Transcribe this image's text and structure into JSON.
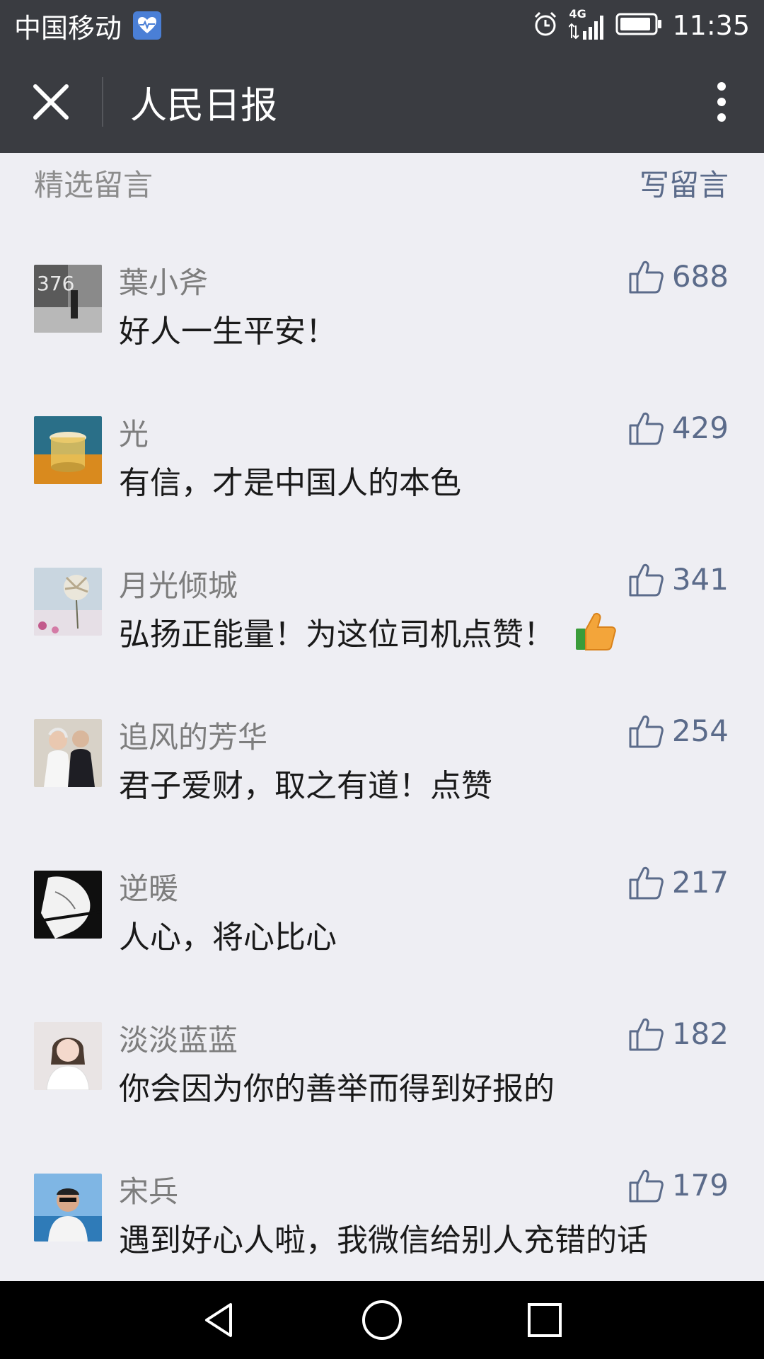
{
  "status_bar": {
    "carrier": "中国移动",
    "network": "4G",
    "time": "11:35"
  },
  "title_bar": {
    "title": "人民日报"
  },
  "section": {
    "title": "精选留言",
    "write_label": "写留言"
  },
  "comments": [
    {
      "nickname": "葉小斧",
      "text": "好人一生平安！",
      "likes": "688",
      "avatar": "avatar-376",
      "emoji": ""
    },
    {
      "nickname": "光",
      "text": "有信，才是中国人的本色",
      "likes": "429",
      "avatar": "avatar-glass",
      "emoji": ""
    },
    {
      "nickname": "月光倾城",
      "text": "弘扬正能量！为这位司机点赞！",
      "likes": "341",
      "avatar": "avatar-flower",
      "emoji": "thumbs-up-emoji"
    },
    {
      "nickname": "追风的芳华",
      "text": "君子爱财，取之有道！点赞",
      "likes": "254",
      "avatar": "avatar-wedding",
      "emoji": ""
    },
    {
      "nickname": "逆暖",
      "text": "人心，将心比心",
      "likes": "217",
      "avatar": "avatar-sketch",
      "emoji": ""
    },
    {
      "nickname": "淡淡蓝蓝",
      "text": "你会因为你的善举而得到好报的",
      "likes": "182",
      "avatar": "avatar-girl",
      "emoji": ""
    },
    {
      "nickname": "宋兵",
      "text": "遇到好心人啦，我微信给别人充错的话",
      "likes": "179",
      "avatar": "avatar-man",
      "emoji": ""
    }
  ],
  "colors": {
    "bar": "#3a3c41",
    "background": "#eeeef3",
    "link": "#5b6b8a",
    "muted": "#8c8c8c"
  }
}
